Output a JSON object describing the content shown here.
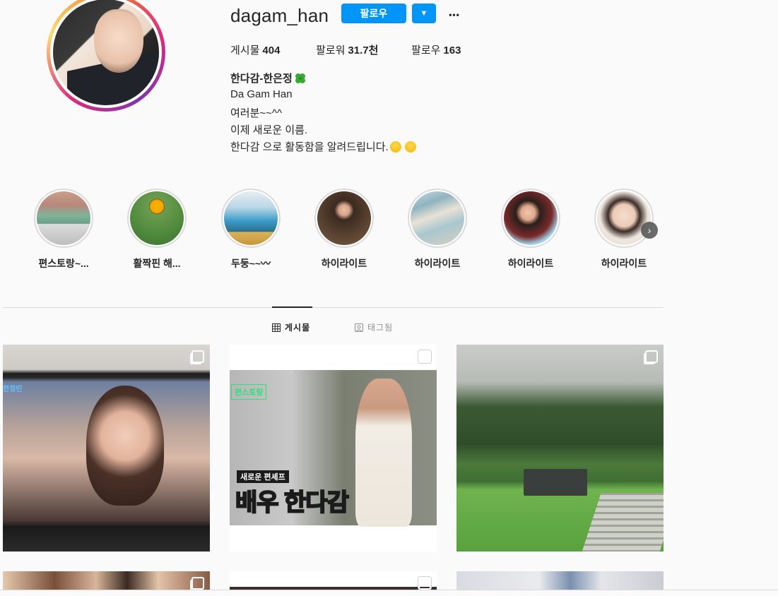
{
  "profile": {
    "username": "dagam_han",
    "follow_label": "팔로우",
    "dropdown_glyph": "▼",
    "more_glyph": "•••",
    "stats": {
      "posts_label": "게시물",
      "posts_value": "404",
      "followers_label": "팔로워",
      "followers_value": "31.7천",
      "following_label": "팔로우",
      "following_value": "163"
    },
    "full_name": "한다감-한은정",
    "bio": {
      "line1": "Da Gam Han",
      "line2": "여러분~~^^",
      "line3": "이제 새로운 이름.",
      "line4": "한다감 으로 활동함을 알려드립니다."
    }
  },
  "highlights": [
    {
      "label": "편스토랑~..."
    },
    {
      "label": "활짝핀 해..."
    },
    {
      "label": "두둥~~〰"
    },
    {
      "label": "하이라이트"
    },
    {
      "label": "하이라이트"
    },
    {
      "label": "하이라이트"
    },
    {
      "label": "하이라이트"
    }
  ],
  "tabs": {
    "posts_label": "게시물",
    "tagged_label": "태그됨"
  },
  "posts": [
    {
      "overlay_text": "한정민"
    },
    {
      "overlay_badge": "편스토랑",
      "caption_small": "새로운 편셰프",
      "caption_big": "배우 한다감"
    },
    {}
  ],
  "colors": {
    "accent": "#0095f6",
    "text": "#262626",
    "background": "#fafafa",
    "border": "#dbdbdb"
  },
  "icons": [
    "clover-icon",
    "smile-emoji-icon",
    "sweat-emoji-icon",
    "grid-icon",
    "tag-icon",
    "multi-post-icon",
    "chevron-right-icon"
  ]
}
